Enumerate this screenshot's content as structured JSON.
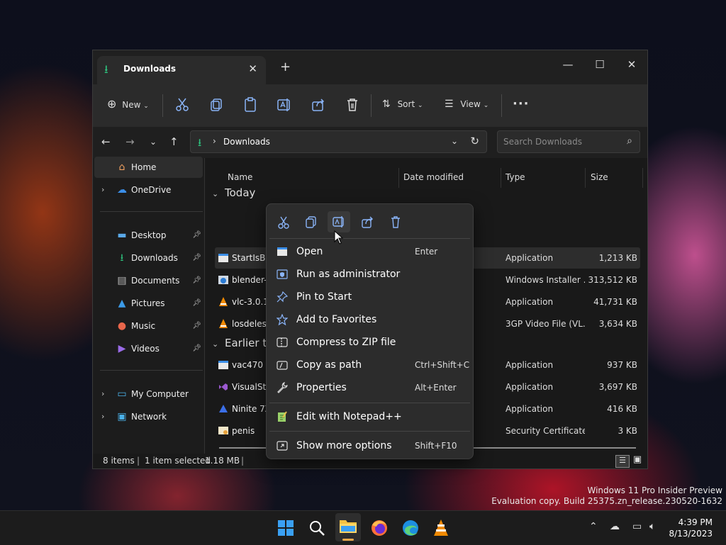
{
  "watermark": {
    "line1": "Windows 11 Pro Insider Preview",
    "line2": "Evaluation copy. Build 25375.zn_release.230520-1632"
  },
  "window": {
    "tab_title": "Downloads",
    "toolbar": {
      "new_label": "New",
      "sort_label": "Sort",
      "view_label": "View"
    },
    "address": {
      "path": "Downloads"
    },
    "search": {
      "placeholder": "Search Downloads"
    },
    "sidebar": {
      "home": "Home",
      "onedrive": "OneDrive",
      "desktop": "Desktop",
      "downloads": "Downloads",
      "documents": "Documents",
      "pictures": "Pictures",
      "music": "Music",
      "videos": "Videos",
      "my_computer": "My Computer",
      "network": "Network"
    },
    "columns": {
      "name": "Name",
      "date": "Date modified",
      "type": "Type",
      "size": "Size"
    },
    "groups": {
      "today": "Today",
      "earlier": "Earlier thi"
    },
    "files_today": [
      {
        "name": "StartIsBac",
        "type": "Application",
        "size": "1,213 KB"
      },
      {
        "name": "blender-3",
        "type": "Windows Installer ...",
        "size": "313,512 KB"
      },
      {
        "name": "vlc-3.0.18",
        "type": "Application",
        "size": "41,731 KB"
      },
      {
        "name": "losdelesp",
        "type": "3GP Video File (VL...",
        "size": "3,634 KB"
      }
    ],
    "files_earlier": [
      {
        "name": "vac470",
        "type": "Application",
        "size": "937 KB"
      },
      {
        "name": "VisualStu",
        "type": "Application",
        "size": "3,697 KB"
      },
      {
        "name": "Ninite 7Z",
        "type": "Application",
        "size": "416 KB"
      },
      {
        "name": "penis",
        "type": "Security Certificate",
        "size": "3 KB"
      }
    ],
    "status": {
      "count": "8 items",
      "selected": "1 item selected",
      "size": "1.18 MB"
    }
  },
  "context_menu": {
    "items": [
      {
        "label": "Open",
        "shortcut": "Enter"
      },
      {
        "label": "Run as administrator",
        "shortcut": ""
      },
      {
        "label": "Pin to Start",
        "shortcut": ""
      },
      {
        "label": "Add to Favorites",
        "shortcut": ""
      },
      {
        "label": "Compress to ZIP file",
        "shortcut": ""
      },
      {
        "label": "Copy as path",
        "shortcut": "Ctrl+Shift+C"
      },
      {
        "label": "Properties",
        "shortcut": "Alt+Enter"
      },
      {
        "label": "Edit with Notepad++",
        "shortcut": ""
      },
      {
        "label": "Show more options",
        "shortcut": "Shift+F10"
      }
    ]
  },
  "taskbar": {
    "time": "4:39 PM",
    "date": "8/13/2023"
  },
  "colors": {
    "accent": "#2ec27e",
    "folder": "#f5c242"
  }
}
